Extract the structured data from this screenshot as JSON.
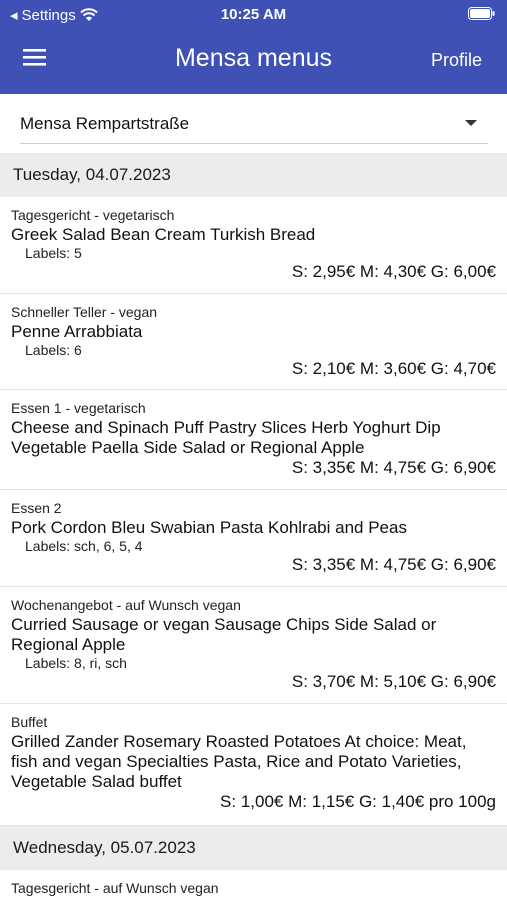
{
  "status": {
    "back": "Settings",
    "time": "10:25 AM"
  },
  "header": {
    "title": "Mensa menus",
    "profile": "Profile"
  },
  "selector": {
    "value": "Mensa Rempartstraße"
  },
  "days": [
    {
      "date": "Tuesday, 04.07.2023",
      "items": [
        {
          "category": "Tagesgericht - vegetarisch",
          "meal": "Greek Salad Bean Cream Turkish Bread",
          "labels": "Labels: 5",
          "price": "S: 2,95€ M: 4,30€ G: 6,00€"
        },
        {
          "category": "Schneller Teller - vegan",
          "meal": "Penne Arrabbiata",
          "labels": "Labels: 6",
          "price": "S: 2,10€ M: 3,60€ G: 4,70€"
        },
        {
          "category": "Essen 1 - vegetarisch",
          "meal": "Cheese and Spinach Puff Pastry Slices Herb Yoghurt Dip Vegetable Paella Side Salad or Regional Apple",
          "labels": "",
          "price": "S: 3,35€ M: 4,75€ G: 6,90€"
        },
        {
          "category": "Essen 2",
          "meal": "Pork Cordon Bleu Swabian Pasta Kohlrabi and Peas",
          "labels": "Labels: sch, 6, 5, 4",
          "price": "S: 3,35€ M: 4,75€ G: 6,90€"
        },
        {
          "category": "Wochenangebot - auf Wunsch vegan",
          "meal": "Curried Sausage or vegan Sausage Chips Side Salad or Regional Apple",
          "labels": "Labels: 8, ri, sch",
          "price": "S: 3,70€ M: 5,10€ G: 6,90€"
        },
        {
          "category": "Buffet",
          "meal": "Grilled Zander Rosemary Roasted Potatoes At choice: Meat, fish and vegan Specialties Pasta, Rice and Potato Varieties, Vegetable Salad buffet",
          "labels": "",
          "price": "S: 1,00€ M: 1,15€ G: 1,40€ pro 100g"
        }
      ]
    },
    {
      "date": "Wednesday, 05.07.2023",
      "items": [
        {
          "category": "Tagesgericht - auf Wunsch vegan",
          "meal": "",
          "labels": "",
          "price": ""
        }
      ]
    }
  ],
  "colors": {
    "appbar": "#3f51b5",
    "dayHeader": "#ececec"
  }
}
